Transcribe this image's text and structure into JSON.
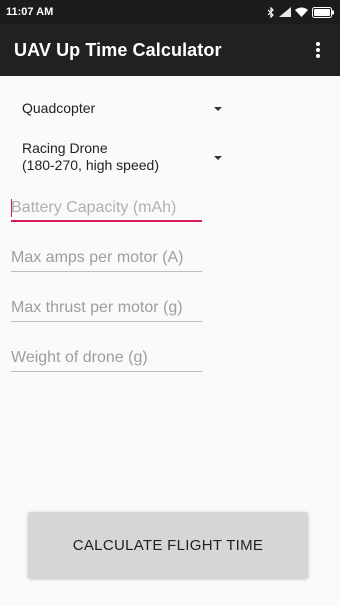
{
  "status_bar": {
    "time": "11:07 AM"
  },
  "app_bar": {
    "title": "UAV Up Time Calculator"
  },
  "spinners": {
    "frame_type": "Quadcopter",
    "drone_class_line1": "Racing Drone",
    "drone_class_line2": "(180-270, high speed)"
  },
  "fields": {
    "battery_capacity_placeholder": "Battery Capacity (mAh)",
    "max_amps_placeholder": "Max amps per motor (A)",
    "max_thrust_placeholder": "Max thrust per motor (g)",
    "weight_placeholder": "Weight of drone (g)"
  },
  "buttons": {
    "calculate": "CALCULATE FLIGHT TIME"
  },
  "colors": {
    "accent": "#d81b60",
    "app_bar": "#212121",
    "status_bar": "#1c1c1c"
  },
  "icons": [
    "bluetooth-icon",
    "signal-icon",
    "wifi-icon",
    "battery-icon",
    "overflow-menu-icon",
    "dropdown-arrow-icon"
  ]
}
